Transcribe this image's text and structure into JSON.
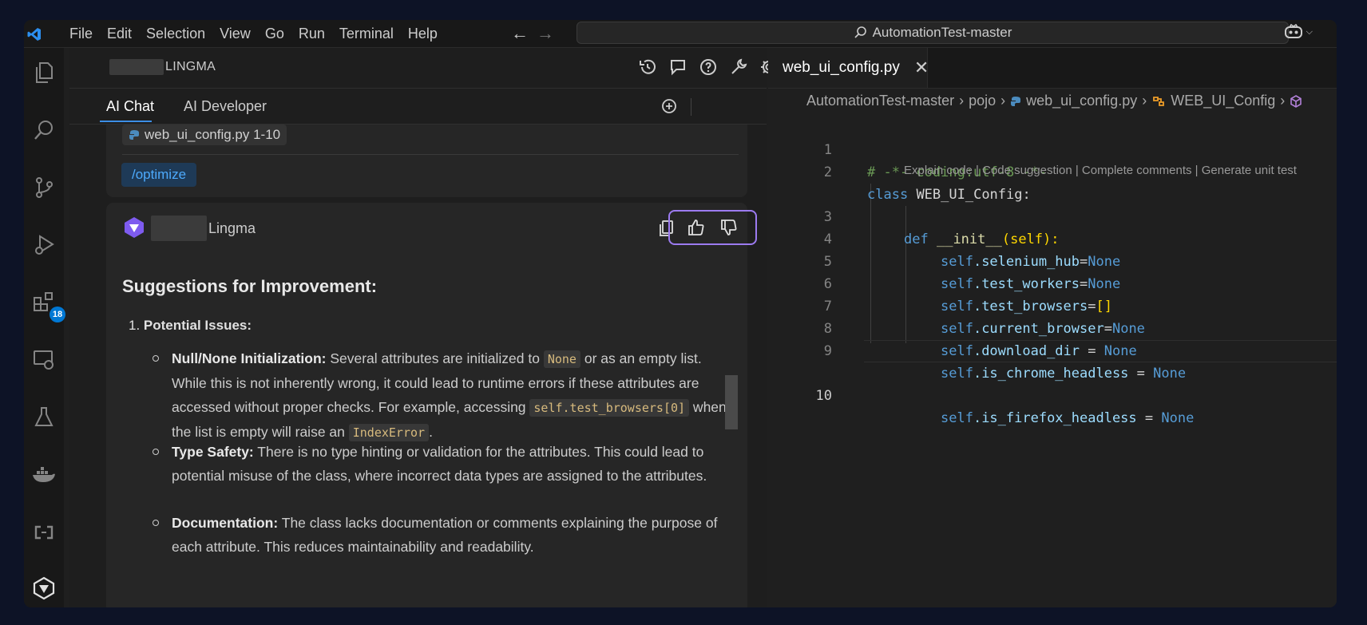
{
  "menu": [
    "File",
    "Edit",
    "Selection",
    "View",
    "Go",
    "Run",
    "Terminal",
    "Help"
  ],
  "command_center": "AutomationTest-master",
  "activity_badge": "18",
  "panel": {
    "title": "LINGMA",
    "tabs": [
      "AI Chat",
      "AI Developer"
    ],
    "context_file": "web_ui_config.py 1-10",
    "command": "/optimize",
    "answer_author": "Lingma",
    "heading": "Suggestions for Improvement:",
    "item_number": "1.",
    "item_title": "Potential Issues:",
    "bullets": [
      {
        "title": "Null/None Initialization:",
        "parts": [
          " Several attributes are initialized to ",
          "None",
          " or as an empty list. While this is not inherently wrong, it could lead to runtime errors if these attributes are accessed without proper checks. For example, accessing ",
          "self.test_browsers[0]",
          " when the list is empty will raise an ",
          "IndexError",
          "."
        ]
      },
      {
        "title": "Type Safety:",
        "text": " There is no type hinting or validation for the attributes. This could lead to potential misuse of the class, where incorrect data types are assigned to the attributes."
      },
      {
        "title": "Documentation:",
        "text": " The class lacks documentation or comments explaining the purpose of each attribute. This reduces maintainability and readability."
      }
    ]
  },
  "editor": {
    "tab_label": "web_ui_config.py",
    "close_glyph": "✕",
    "breadcrumb": [
      "AutomationTest-master",
      "pojo",
      "web_ui_config.py",
      "WEB_UI_Config"
    ],
    "codelens": "Explain code | Code suggestion | Complete comments | Generate unit test",
    "line_numbers": [
      "1",
      "2",
      "3",
      "4",
      "5",
      "6",
      "7",
      "8",
      "9",
      "10"
    ],
    "code": {
      "l1": "# -*- coding:utf-8 -*-",
      "l2_kw": "class",
      "l2_name": "WEB_UI_Config",
      "l2_colon": ":",
      "l3_kw": "def",
      "l3_fn": "__init__",
      "l3_rest": "(self):",
      "l4": [
        "self",
        ".selenium_hub",
        "=",
        "None"
      ],
      "l5": [
        "self",
        ".test_workers",
        "=",
        "None"
      ],
      "l6": [
        "self",
        ".test_browsers",
        "=",
        "[]"
      ],
      "l7": [
        "self",
        ".current_browser",
        "=",
        "None"
      ],
      "l8": [
        "self",
        ".download_dir",
        " = ",
        "None"
      ],
      "l9": [
        "self",
        ".is_chrome_headless",
        " = ",
        "None"
      ],
      "l10": [
        "self",
        ".is_firefox_headless",
        " = ",
        "None"
      ]
    }
  },
  "colors": {
    "accent": "#3c8ee6",
    "feedback_highlight": "#9c7bf0",
    "badge": "#0078d4"
  }
}
